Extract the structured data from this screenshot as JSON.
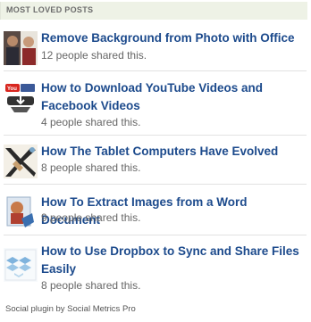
{
  "widget": {
    "header_title": "MOST LOVED POSTS",
    "posts": [
      {
        "title": "Remove Background from Photo with Office",
        "shares": "12 people shared this.",
        "icon": "photo-people-thumbnail-icon"
      },
      {
        "title": "How to Download YouTube Videos and Facebook Videos",
        "shares": "4 people shared this.",
        "icon": "youtube-download-thumbnail-icon"
      },
      {
        "title": "How The Tablet Computers Have Evolved",
        "shares": "8 people shared this.",
        "icon": "tablet-thumbnail-icon"
      },
      {
        "title": "How To Extract Images from a Word Document",
        "shares": "9 people shared this.",
        "icon": "word-images-thumbnail-icon"
      },
      {
        "title": "How to Use Dropbox to Sync and Share Files Easily",
        "shares": "8 people shared this.",
        "icon": "dropbox-thumbnail-icon"
      }
    ],
    "footer": "Social plugin by Social Metrics Pro"
  },
  "colors": {
    "link": "#1c4a8c",
    "header_bg": "#eef2e6",
    "muted_text": "#666666"
  }
}
